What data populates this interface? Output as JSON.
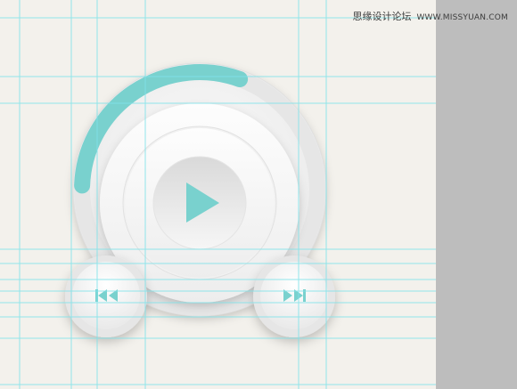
{
  "watermark": {
    "site_name": "思缘设计论坛",
    "site_url": "WWW.MISSYUAN.COM"
  },
  "player": {
    "progress": 0.3,
    "accent_color": "#79d1ce",
    "play_button": {
      "icon": "play-icon"
    },
    "prev_button": {
      "icon": "skip-back-icon"
    },
    "next_button": {
      "icon": "skip-forward-icon"
    }
  },
  "colors": {
    "canvas_bg": "#f3f1ec",
    "side_panel": "#bdbdbd",
    "guide_lines": "#7fe3ea"
  }
}
